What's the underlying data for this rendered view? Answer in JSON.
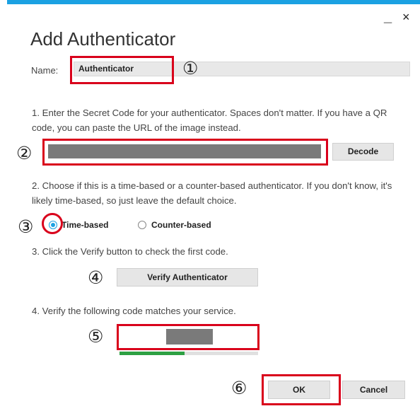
{
  "window": {
    "title": "Add Authenticator",
    "minimize_glyph": "_",
    "close_glyph": "×",
    "accent_color": "#1ba1e2"
  },
  "name_field": {
    "label": "Name:",
    "value": "Authenticator"
  },
  "step1": {
    "text": "1. Enter the Secret Code for your authenticator. Spaces don't matter. If you have a QR code, you can paste the URL of the image instead.",
    "secret_value": "",
    "decode_label": "Decode"
  },
  "step2": {
    "text": "2. Choose if this is a time-based or a counter-based authenticator. If you don't know, it's likely time-based, so just leave the default choice.",
    "options": [
      {
        "label": "Time-based",
        "selected": true
      },
      {
        "label": "Counter-based",
        "selected": false
      }
    ]
  },
  "step3": {
    "text": "3. Click the Verify button to check the first code.",
    "verify_label": "Verify Authenticator"
  },
  "step4": {
    "text": "4. Verify the following code matches your service.",
    "code_value": "",
    "progress": 0.47,
    "progress_color": "#2ea043"
  },
  "footer": {
    "ok_label": "OK",
    "cancel_label": "Cancel"
  },
  "annotations": {
    "highlight_color": "#d9001b",
    "markers": [
      "①",
      "②",
      "③",
      "④",
      "⑤",
      "⑥"
    ]
  }
}
